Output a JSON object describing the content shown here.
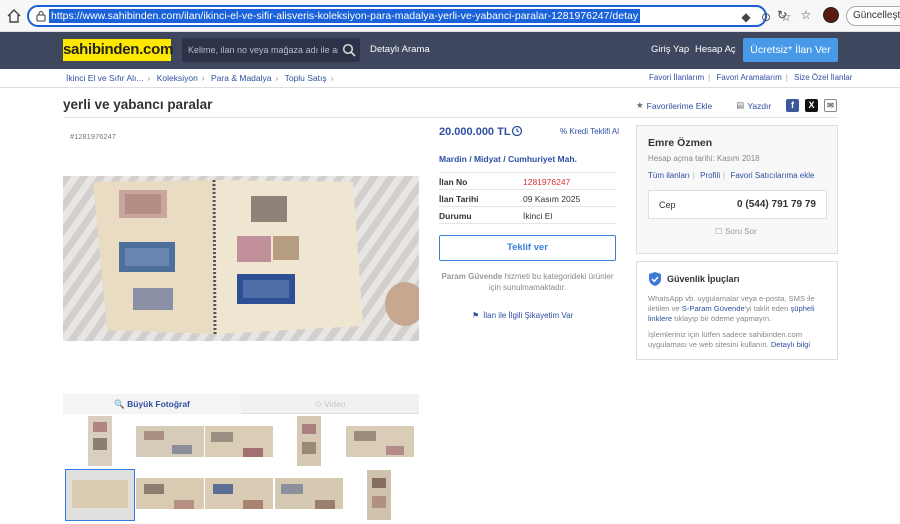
{
  "browser": {
    "url": "https://www.sahibinden.com/ilan/ikinci-el-ve-sifir-alisveris-koleksiyon-para-madalya-yerli-ve-yabanci-paralar-1281976247/detay",
    "update_label": "Güncelleştir"
  },
  "header": {
    "logo": "sahibinden.com",
    "search_placeholder": "Kelime, ilan no veya mağaza adı ile ara",
    "detail_search": "Detaylı Arama",
    "login": "Giriş Yap",
    "register": "Hesap Aç",
    "post_ad": "Ücretsiz* İlan Ver"
  },
  "breadcrumb": [
    "İkinci El ve Sıfır Alı...",
    "Koleksiyon",
    "Para & Madalya",
    "Toplu Satış"
  ],
  "fav_links": [
    "Favori İlanlarım",
    "Favori Aramalarım",
    "Size Özel İlanlar"
  ],
  "listing": {
    "title": "yerli ve yabancı paralar",
    "add_fav": "Favorilerime Ekle",
    "print": "Yazdır",
    "id_label": "#1281976247",
    "price": "20.000.000 TL",
    "credit": "Kredi Teklifi Al",
    "location": "Mardin  /  Midyat  /  Cumhuriyet Mah.",
    "rows": [
      {
        "k": "İlan No",
        "v": "1281976247"
      },
      {
        "k": "İlan Tarihi",
        "v": "09 Kasım 2025"
      },
      {
        "k": "Durumu",
        "v": "İkinci El"
      }
    ],
    "offer_button": "Teklif ver",
    "param_bold": "Param Güvende",
    "param_rest": " hizmeti bu kategorideki ürünler için sunulmamaktadır.",
    "report": "İlan ile İlgili Şikayetim Var",
    "tab_photo": "Büyük Fotoğraf",
    "tab_video": "Video"
  },
  "seller": {
    "name": "Emre Özmen",
    "since": "Hesap açma tarihi: Kasım 2018",
    "links": [
      "Tüm ilanları",
      "Profili",
      "Favori Satıcılarıma ekle"
    ],
    "phone_label": "Cep",
    "phone": "0 (544) 791 79 79",
    "ask": "Soru Sor"
  },
  "security": {
    "title": "Güvenlik İpuçları",
    "t1": "WhatsApp vb. uygulamalar veya e-posta, SMS ile iletilen ve ",
    "t1_hl": "S-Param Güvende",
    "t1b": "'yi taklit eden ",
    "t1_bold": "şüpheli linklere",
    "t1c": " tıklayıp bir ödeme yapmayın.",
    "t2": "İşlemleriniz için lütfen sadece sahibinden.com uygulaması ve web sitesini kullanın. ",
    "t2_hl": "Detaylı bilgi"
  },
  "colors": {
    "header_bg": "#3f475f",
    "logo_bg": "#ffe800",
    "link_blue": "#2f4fa0",
    "button_blue": "#489ae9",
    "id_red": "#d33"
  }
}
